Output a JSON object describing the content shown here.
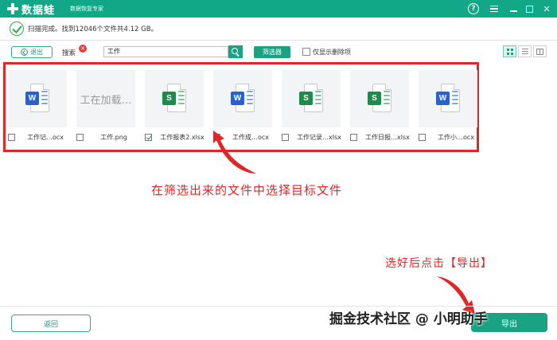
{
  "app": {
    "name": "数据蛙",
    "subtitle": "数据恢复专家",
    "help_label": "?",
    "close_label": "✕"
  },
  "status": {
    "text": "扫描完成。找到12046个文件共4.12 GB。"
  },
  "toolbar": {
    "exit_label": "退出",
    "search_label": "搜索",
    "clear_label": "✕",
    "search_value": "工作",
    "filter_label": "筛选器",
    "show_deleted_label": "仅显示删除项",
    "show_deleted_checked": false
  },
  "files": [
    {
      "name": "工作记…ocx",
      "type": "word",
      "badge": "W",
      "checked": false
    },
    {
      "name": "工作.png",
      "type": "image",
      "loading_text": "工在加载…",
      "checked": false
    },
    {
      "name": "工作报表2.xlsx",
      "type": "excel",
      "badge": "S",
      "checked": true
    },
    {
      "name": "工作成…ocx",
      "type": "word",
      "badge": "W",
      "checked": false
    },
    {
      "name": "工作记录…xlsx",
      "type": "excel",
      "badge": "S",
      "checked": false
    },
    {
      "name": "工作日报…xlsx",
      "type": "excel",
      "badge": "S",
      "checked": false
    },
    {
      "name": "工作小…ocx",
      "type": "word",
      "badge": "W",
      "checked": false
    }
  ],
  "annotations": {
    "select_hint": "在筛选出来的文件中选择目标文件",
    "export_hint": "选好后点击【导出】"
  },
  "footer": {
    "back_label": "返回",
    "export_label": "导出",
    "watermark": "掘金技术社区 @ 小明助手"
  },
  "colors": {
    "brand": "#12a887",
    "accent": "#1aa383",
    "annotation": "#e02626",
    "word": "#2b62c9",
    "excel": "#1f8a4c"
  }
}
